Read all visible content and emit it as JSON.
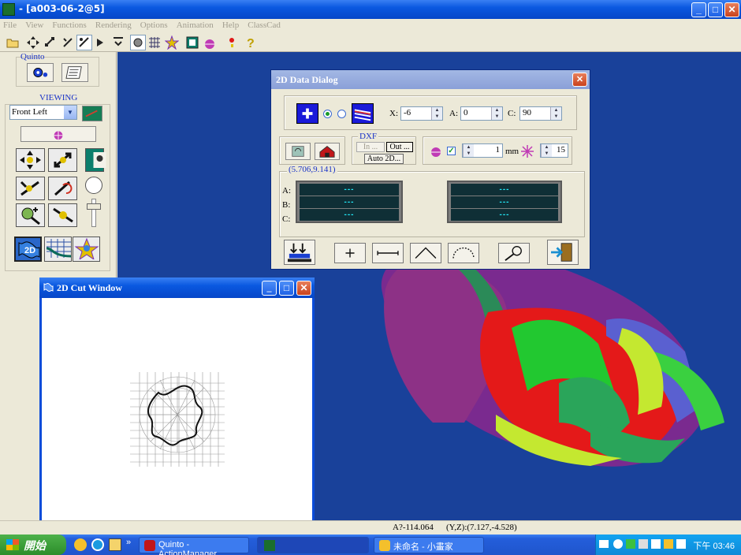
{
  "window": {
    "title": "- [a003-06-2@5]"
  },
  "menu": [
    "File",
    "View",
    "Functions",
    "Rendering",
    "Options",
    "Animation",
    "Help",
    "ClassCad"
  ],
  "left_panel": {
    "quinto_label": "Quinto",
    "viewing_label": "VIEWING",
    "view_select": "Front Left"
  },
  "dialog": {
    "title": "2D Data Dialog",
    "x_label": "X:",
    "x_value": "-6",
    "a_label": "A:",
    "a_value": "0",
    "c_label": "C:",
    "c_value": "90",
    "dxf_label": "DXF",
    "dxf_in": "In ...",
    "dxf_out": "Out ...",
    "auto2d": "Auto 2D...",
    "mm_value": "1",
    "mm_unit": "mm",
    "angle_value": "15",
    "coord": "(5.706,9.141)",
    "row_a": "A:",
    "row_b": "B:",
    "row_c": "C:",
    "readout_left": [
      "---",
      "---",
      "---"
    ],
    "readout_right": [
      "---",
      "---",
      "---"
    ]
  },
  "cut_window": {
    "title": "2D Cut Window"
  },
  "status": {
    "angle": "A?-114.064",
    "yz": "(Y,Z):(7.127,-4.528)"
  },
  "taskbar": {
    "start": "開始",
    "tasks": [
      "Quinto - ActionManager",
      "",
      "未命名 - 小畫家"
    ],
    "clock": "下午 03:46"
  },
  "colors": {
    "viewport": "#19419a",
    "titlebar": "#0a58e0",
    "readout_text": "#22e7f5"
  }
}
